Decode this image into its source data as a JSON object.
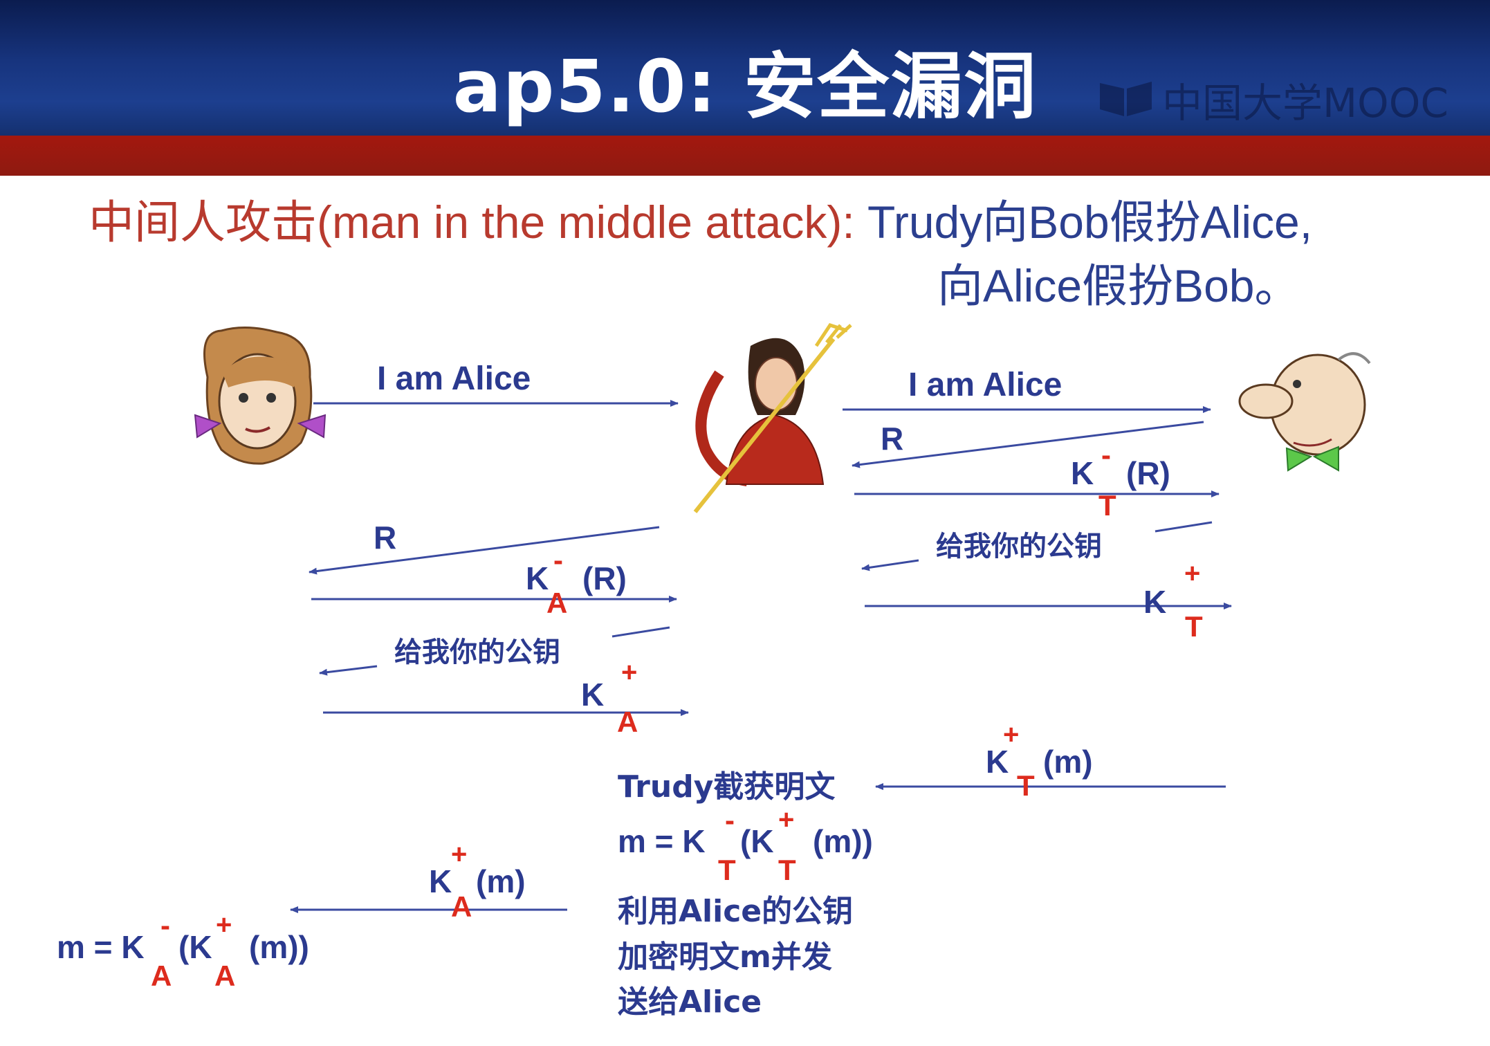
{
  "slide": {
    "title": "ap5.0: 安全漏洞",
    "logo_text": "中国大学MOOC",
    "subtitle_red": "中间人攻击(man in the middle attack): ",
    "subtitle_blue": "Trudy向Bob假扮Alice,",
    "subtitle_blue_line2": "向Alice假扮Bob。"
  },
  "diagram": {
    "alice_to_trudy": "I am Alice",
    "trudy_to_bob": "I am Alice",
    "R": "R",
    "K": "K",
    "minus": "-",
    "plus": "+",
    "sub_T": "T",
    "sub_A": "A",
    "paren_R": "(R)",
    "paren_m": "(m)",
    "give_key": "给我你的公钥",
    "trudy_intercepts": "Trudy截获明文",
    "m_eq_prefix": "m = K",
    "paren_open_K": "(K",
    "paren_m_close": "(m))",
    "reencrypt_line1": "利用Alice的公钥",
    "reencrypt_line2": "加密明文m并发",
    "reencrypt_line3": "送给Alice"
  },
  "colors": {
    "header_blue": "#17347e",
    "header_red": "#a3180f",
    "label_blue": "#2b3a8f",
    "label_red": "#dd2b1d",
    "subtitle_red": "#b83a2e"
  }
}
